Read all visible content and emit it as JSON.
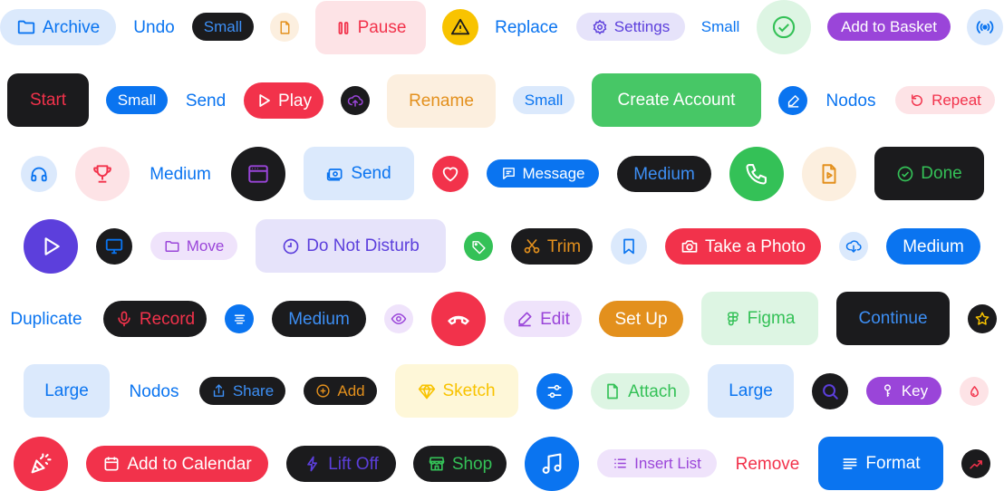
{
  "colors": {
    "blue": "#0a74f0",
    "blue_light": "#dbe9fc",
    "dark": "#1b1b1d",
    "red": "#f2324b",
    "red_light": "#fde3e6",
    "green": "#34c157",
    "green_light": "#ddf5e3",
    "orange": "#e3901d",
    "orange_light": "#fcefdf",
    "purple": "#9a45d9",
    "purple_light": "#efe3fb",
    "indigo": "#5c3fdc",
    "indigo_light": "#e6e3fa",
    "yellow": "#f8c300",
    "yellow_light": "#fef7d8"
  },
  "row1": {
    "archive": "Archive",
    "undo": "Undo",
    "small_dark": "Small",
    "file_icon": "file-icon",
    "pause": "Pause",
    "warning_icon": "warning-icon",
    "replace": "Replace",
    "settings": "Settings",
    "small_text": "Small",
    "check_icon": "check-circle-icon",
    "add_to_basket": "Add to Basket",
    "broadcast_icon": "broadcast-icon"
  },
  "row2": {
    "start": "Start",
    "small_blue": "Small",
    "send": "Send",
    "play": "Play",
    "upload_icon": "cloud-upload-icon",
    "rename": "Rename",
    "small_light": "Small",
    "create_account": "Create Account",
    "edit_icon": "edit-icon",
    "nodos": "Nodos",
    "repeat": "Repeat"
  },
  "row3": {
    "headphones_icon": "headphones-icon",
    "trophy_icon": "trophy-icon",
    "medium_text": "Medium",
    "browser_icon": "browser-icon",
    "send": "Send",
    "heart_icon": "heart-icon",
    "message": "Message",
    "medium_dark": "Medium",
    "phone_icon": "phone-icon",
    "video_file_icon": "video-file-icon",
    "done": "Done"
  },
  "row4": {
    "play_icon": "play-icon",
    "monitor_icon": "monitor-icon",
    "move": "Move",
    "do_not_disturb": "Do Not Disturb",
    "tag_icon": "tag-icon",
    "trim": "Trim",
    "bookmark_icon": "bookmark-icon",
    "take_a_photo": "Take a Photo",
    "download_icon": "cloud-download-icon",
    "medium_blue": "Medium"
  },
  "row5": {
    "duplicate": "Duplicate",
    "record": "Record",
    "align_icon": "align-center-icon",
    "medium_dark": "Medium",
    "eye_icon": "eye-icon",
    "hangup_icon": "phone-hangup-icon",
    "edit": "Edit",
    "set_up": "Set Up",
    "figma": "Figma",
    "continue": "Continue",
    "star_icon": "star-icon"
  },
  "row6": {
    "large_light": "Large",
    "nodos": "Nodos",
    "share": "Share",
    "add": "Add",
    "sketch": "Sketch",
    "sliders_icon": "sliders-icon",
    "attach": "Attach",
    "large_light2": "Large",
    "search_icon": "search-icon",
    "key": "Key",
    "drop_icon": "drop-icon"
  },
  "row7": {
    "party_icon": "party-popper-icon",
    "add_to_calendar": "Add to Calendar",
    "lift_off": "Lift Off",
    "shop": "Shop",
    "music_icon": "music-icon",
    "insert_list": "Insert List",
    "remove": "Remove",
    "format": "Format",
    "trend_icon": "trend-up-icon"
  }
}
